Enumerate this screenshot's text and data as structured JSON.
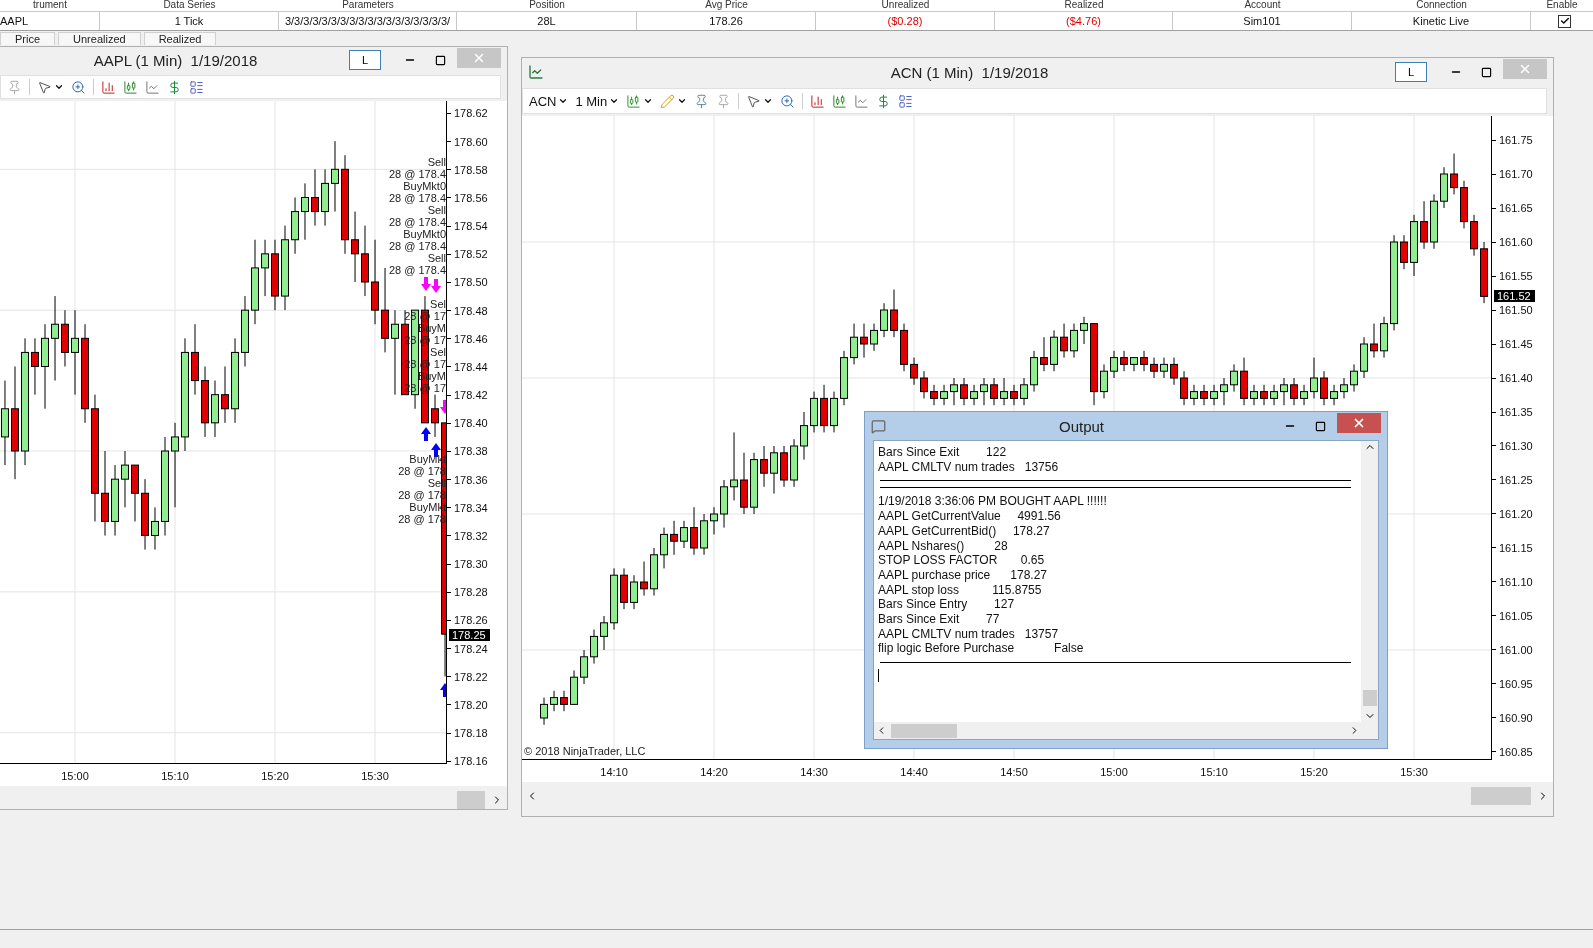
{
  "positions_grid": {
    "columns": [
      "trument",
      "Data Series",
      "Parameters",
      "Position",
      "Avg Price",
      "Unrealized",
      "Realized",
      "Account",
      "Connection",
      "Enable"
    ],
    "row": [
      {
        "kind": "text",
        "text": "AAPL",
        "negative": false
      },
      {
        "kind": "text",
        "text": "1 Tick",
        "negative": false
      },
      {
        "kind": "text",
        "text": "3/3/3/3/3/3/3/3/3/3/3/3/3/3/3/3/3/3/",
        "negative": false
      },
      {
        "kind": "text",
        "text": "28L",
        "negative": false
      },
      {
        "kind": "text",
        "text": "178.26",
        "negative": false
      },
      {
        "kind": "text",
        "text": "($0.28)",
        "negative": true
      },
      {
        "kind": "text",
        "text": "($4.76)",
        "negative": true
      },
      {
        "kind": "text",
        "text": "Sim101",
        "negative": false
      },
      {
        "kind": "text",
        "text": "Kinetic Live",
        "negative": false
      },
      {
        "kind": "checkbox",
        "checked": true
      }
    ]
  },
  "tabs": [
    "Price",
    "Unrealized",
    "Realized"
  ],
  "charts": [
    {
      "title": "AAPL (1 Min)  1/19/2018",
      "lock_label": "L",
      "last_price": "178.25",
      "trade_labels": [
        [
          "Sell",
          "28 @ 178.4",
          "BuyMkt0",
          "28 @ 178.4",
          "Sell",
          "28 @ 178.4",
          "BuyMkt0",
          "28 @ 178.4",
          "Sell",
          "28 @ 178.4"
        ],
        [
          "Sel",
          "28 @ 17",
          "BuyM",
          "28 @ 17",
          "Sel",
          "28 @ 17",
          "BuyM",
          "28 @ 17"
        ],
        [
          "BuyMkt",
          "28 @ 178",
          "Sell",
          "28 @ 178",
          "BuyMkt",
          "28 @ 178"
        ]
      ],
      "chart_data": {
        "type": "candlestick",
        "grid": true,
        "x": [
          14.8833,
          14.9,
          14.9167,
          14.9333,
          14.95,
          14.9667,
          14.9833,
          15,
          15.0167,
          15.0333,
          15.05,
          15.0667,
          15.0833,
          15.1,
          15.1167,
          15.1333,
          15.15,
          15.1667,
          15.1833,
          15.2,
          15.2167,
          15.2333,
          15.25,
          15.2667,
          15.2833,
          15.3,
          15.3167,
          15.3333,
          15.35,
          15.3667,
          15.3833,
          15.4,
          15.4167,
          15.4333,
          15.45,
          15.4667,
          15.4833,
          15.5,
          15.5167,
          15.5333,
          15.55,
          15.5667,
          15.5833,
          15.6,
          15.6167
        ],
        "ohlc": [
          [
            178.39,
            178.43,
            178.37,
            178.41
          ],
          [
            178.41,
            178.44,
            178.36,
            178.38
          ],
          [
            178.38,
            178.46,
            178.37,
            178.45
          ],
          [
            178.45,
            178.46,
            178.42,
            178.44
          ],
          [
            178.44,
            178.47,
            178.41,
            178.46
          ],
          [
            178.46,
            178.49,
            178.43,
            178.47
          ],
          [
            178.47,
            178.48,
            178.44,
            178.45
          ],
          [
            178.45,
            178.48,
            178.42,
            178.46
          ],
          [
            178.46,
            178.47,
            178.4,
            178.41
          ],
          [
            178.41,
            178.42,
            178.33,
            178.35
          ],
          [
            178.35,
            178.38,
            178.32,
            178.33
          ],
          [
            178.33,
            178.37,
            178.32,
            178.36
          ],
          [
            178.36,
            178.38,
            178.34,
            178.37
          ],
          [
            178.37,
            178.37,
            178.33,
            178.35
          ],
          [
            178.35,
            178.36,
            178.31,
            178.32
          ],
          [
            178.32,
            178.34,
            178.31,
            178.33
          ],
          [
            178.33,
            178.39,
            178.32,
            178.38
          ],
          [
            178.38,
            178.4,
            178.34,
            178.39
          ],
          [
            178.39,
            178.46,
            178.38,
            178.45
          ],
          [
            178.45,
            178.47,
            178.42,
            178.43
          ],
          [
            178.43,
            178.44,
            178.39,
            178.4
          ],
          [
            178.4,
            178.43,
            178.39,
            178.42
          ],
          [
            178.42,
            178.44,
            178.4,
            178.41
          ],
          [
            178.41,
            178.46,
            178.4,
            178.45
          ],
          [
            178.45,
            178.49,
            178.44,
            178.48
          ],
          [
            178.48,
            178.53,
            178.47,
            178.51
          ],
          [
            178.51,
            178.53,
            178.49,
            178.52
          ],
          [
            178.52,
            178.53,
            178.48,
            178.49
          ],
          [
            178.49,
            178.54,
            178.48,
            178.53
          ],
          [
            178.53,
            178.56,
            178.52,
            178.55
          ],
          [
            178.55,
            178.57,
            178.53,
            178.56
          ],
          [
            178.56,
            178.58,
            178.54,
            178.55
          ],
          [
            178.55,
            178.58,
            178.54,
            178.57
          ],
          [
            178.57,
            178.6,
            178.55,
            178.58
          ],
          [
            178.58,
            178.59,
            178.52,
            178.53
          ],
          [
            178.53,
            178.55,
            178.5,
            178.52
          ],
          [
            178.52,
            178.54,
            178.49,
            178.5
          ],
          [
            178.5,
            178.53,
            178.47,
            178.48
          ],
          [
            178.48,
            178.51,
            178.45,
            178.46
          ],
          [
            178.46,
            178.48,
            178.42,
            178.47
          ],
          [
            178.47,
            178.48,
            178.42,
            178.42
          ],
          [
            178.42,
            178.48,
            178.41,
            178.48
          ],
          [
            178.48,
            178.49,
            178.4,
            178.4
          ],
          [
            178.41,
            178.42,
            178.39,
            178.4
          ],
          [
            178.4,
            178.4,
            178.22,
            178.25
          ]
        ],
        "xticks": [
          {
            "value": 15,
            "label": "15:00"
          },
          {
            "value": 15.1667,
            "label": "15:10"
          },
          {
            "value": 15.3333,
            "label": "15:20"
          },
          {
            "value": 15.5,
            "label": "15:30"
          }
        ],
        "xlim": [
          14.875,
          15.6183
        ],
        "ylim": [
          178.1585,
          178.6285
        ],
        "yticks": [
          {
            "value": 178.62,
            "label": "178.62"
          },
          {
            "value": 178.6,
            "label": "178.60"
          },
          {
            "value": 178.58,
            "label": "178.58"
          },
          {
            "value": 178.56,
            "label": "178.56"
          },
          {
            "value": 178.54,
            "label": "178.54"
          },
          {
            "value": 178.52,
            "label": "178.52"
          },
          {
            "value": 178.5,
            "label": "178.50"
          },
          {
            "value": 178.48,
            "label": "178.48"
          },
          {
            "value": 178.46,
            "label": "178.46"
          },
          {
            "value": 178.44,
            "label": "178.44"
          },
          {
            "value": 178.42,
            "label": "178.42"
          },
          {
            "value": 178.4,
            "label": "178.40"
          },
          {
            "value": 178.38,
            "label": "178.38"
          },
          {
            "value": 178.36,
            "label": "178.36"
          },
          {
            "value": 178.34,
            "label": "178.34"
          },
          {
            "value": 178.32,
            "label": "178.32"
          },
          {
            "value": 178.3,
            "label": "178.30"
          },
          {
            "value": 178.28,
            "label": "178.28"
          },
          {
            "value": 178.26,
            "label": "178.26"
          },
          {
            "value": 178.24,
            "label": "178.24"
          },
          {
            "value": 178.22,
            "label": "178.22"
          },
          {
            "value": 178.2,
            "label": "178.20"
          },
          {
            "value": 178.18,
            "label": "178.18"
          },
          {
            "value": 178.16,
            "label": "178.16"
          }
        ]
      }
    },
    {
      "title": "ACN (1 Min)  1/19/2018",
      "lock_label": "L",
      "instrument": "ACN",
      "interval": "1 Min",
      "last_price": "161.52",
      "copyright": "© 2018 NinjaTrader, LLC",
      "chart_data": {
        "type": "candlestick",
        "grid": true,
        "x": [
          14.05,
          14.0667,
          14.0833,
          14.1,
          14.1167,
          14.1333,
          14.15,
          14.1667,
          14.1833,
          14.2,
          14.2167,
          14.2333,
          14.25,
          14.2667,
          14.2833,
          14.3,
          14.3167,
          14.3333,
          14.35,
          14.3667,
          14.3833,
          14.4,
          14.4167,
          14.4333,
          14.45,
          14.4667,
          14.4833,
          14.5,
          14.5167,
          14.5333,
          14.55,
          14.5667,
          14.5833,
          14.6,
          14.6167,
          14.6333,
          14.65,
          14.6667,
          14.6833,
          14.7,
          14.7167,
          14.7333,
          14.75,
          14.7667,
          14.7833,
          14.8,
          14.8167,
          14.8333,
          14.85,
          14.8667,
          14.8833,
          14.9,
          14.9167,
          14.9333,
          14.95,
          14.9667,
          14.9833,
          15,
          15.0167,
          15.0333,
          15.05,
          15.0667,
          15.0833,
          15.1,
          15.1167,
          15.1333,
          15.15,
          15.1667,
          15.1833,
          15.2,
          15.2167,
          15.2333,
          15.25,
          15.2667,
          15.2833,
          15.3,
          15.3167,
          15.3333,
          15.35,
          15.3667,
          15.3833,
          15.4,
          15.4167,
          15.4333,
          15.45,
          15.4667,
          15.4833,
          15.5,
          15.5167,
          15.5333,
          15.55,
          15.5667,
          15.5833,
          15.6,
          15.6167
        ],
        "ohlc": [
          [
            160.9,
            160.93,
            160.89,
            160.92
          ],
          [
            160.92,
            160.94,
            160.91,
            160.93
          ],
          [
            160.93,
            160.94,
            160.91,
            160.92
          ],
          [
            160.92,
            160.97,
            160.92,
            160.96
          ],
          [
            160.96,
            161.0,
            160.95,
            160.99
          ],
          [
            160.99,
            161.03,
            160.98,
            161.02
          ],
          [
            161.02,
            161.05,
            161.0,
            161.04
          ],
          [
            161.04,
            161.12,
            161.03,
            161.11
          ],
          [
            161.11,
            161.12,
            161.06,
            161.07
          ],
          [
            161.07,
            161.11,
            161.06,
            161.1
          ],
          [
            161.1,
            161.13,
            161.08,
            161.09
          ],
          [
            161.09,
            161.15,
            161.08,
            161.14
          ],
          [
            161.14,
            161.18,
            161.12,
            161.17
          ],
          [
            161.17,
            161.19,
            161.14,
            161.16
          ],
          [
            161.16,
            161.19,
            161.15,
            161.18
          ],
          [
            161.18,
            161.21,
            161.14,
            161.15
          ],
          [
            161.15,
            161.2,
            161.14,
            161.19
          ],
          [
            161.19,
            161.21,
            161.17,
            161.2
          ],
          [
            161.2,
            161.25,
            161.18,
            161.24
          ],
          [
            161.24,
            161.32,
            161.22,
            161.25
          ],
          [
            161.25,
            161.29,
            161.2,
            161.21
          ],
          [
            161.21,
            161.29,
            161.2,
            161.28
          ],
          [
            161.28,
            161.3,
            161.24,
            161.26
          ],
          [
            161.26,
            161.3,
            161.23,
            161.29
          ],
          [
            161.29,
            161.3,
            161.24,
            161.25
          ],
          [
            161.25,
            161.31,
            161.24,
            161.3
          ],
          [
            161.3,
            161.35,
            161.28,
            161.33
          ],
          [
            161.33,
            161.38,
            161.32,
            161.37
          ],
          [
            161.37,
            161.39,
            161.32,
            161.33
          ],
          [
            161.33,
            161.38,
            161.32,
            161.37
          ],
          [
            161.37,
            161.44,
            161.36,
            161.43
          ],
          [
            161.43,
            161.48,
            161.42,
            161.46
          ],
          [
            161.46,
            161.48,
            161.43,
            161.45
          ],
          [
            161.45,
            161.48,
            161.44,
            161.47
          ],
          [
            161.47,
            161.51,
            161.46,
            161.5
          ],
          [
            161.5,
            161.53,
            161.46,
            161.47
          ],
          [
            161.47,
            161.48,
            161.41,
            161.42
          ],
          [
            161.42,
            161.43,
            161.39,
            161.4
          ],
          [
            161.4,
            161.41,
            161.37,
            161.38
          ],
          [
            161.38,
            161.39,
            161.36,
            161.37
          ],
          [
            161.37,
            161.39,
            161.36,
            161.38
          ],
          [
            161.38,
            161.4,
            161.36,
            161.39
          ],
          [
            161.39,
            161.4,
            161.36,
            161.37
          ],
          [
            161.37,
            161.39,
            161.36,
            161.38
          ],
          [
            161.38,
            161.4,
            161.36,
            161.39
          ],
          [
            161.39,
            161.4,
            161.36,
            161.37
          ],
          [
            161.37,
            161.4,
            161.36,
            161.38
          ],
          [
            161.38,
            161.39,
            161.36,
            161.37
          ],
          [
            161.37,
            161.4,
            161.36,
            161.39
          ],
          [
            161.39,
            161.44,
            161.38,
            161.43
          ],
          [
            161.43,
            161.46,
            161.41,
            161.42
          ],
          [
            161.42,
            161.47,
            161.41,
            161.46
          ],
          [
            161.46,
            161.48,
            161.43,
            161.44
          ],
          [
            161.44,
            161.48,
            161.43,
            161.47
          ],
          [
            161.47,
            161.49,
            161.45,
            161.48
          ],
          [
            161.48,
            161.48,
            161.36,
            161.38
          ],
          [
            161.38,
            161.42,
            161.37,
            161.41
          ],
          [
            161.41,
            161.44,
            161.4,
            161.43
          ],
          [
            161.43,
            161.44,
            161.41,
            161.42
          ],
          [
            161.42,
            161.43,
            161.41,
            161.43
          ],
          [
            161.43,
            161.44,
            161.41,
            161.42
          ],
          [
            161.42,
            161.43,
            161.4,
            161.41
          ],
          [
            161.41,
            161.43,
            161.4,
            161.42
          ],
          [
            161.42,
            161.43,
            161.39,
            161.4
          ],
          [
            161.4,
            161.41,
            161.36,
            161.37
          ],
          [
            161.37,
            161.39,
            161.36,
            161.38
          ],
          [
            161.38,
            161.39,
            161.36,
            161.37
          ],
          [
            161.37,
            161.39,
            161.36,
            161.38
          ],
          [
            161.38,
            161.4,
            161.36,
            161.39
          ],
          [
            161.39,
            161.42,
            161.38,
            161.41
          ],
          [
            161.41,
            161.43,
            161.36,
            161.37
          ],
          [
            161.37,
            161.39,
            161.36,
            161.38
          ],
          [
            161.38,
            161.39,
            161.36,
            161.37
          ],
          [
            161.37,
            161.39,
            161.36,
            161.38
          ],
          [
            161.38,
            161.4,
            161.36,
            161.39
          ],
          [
            161.39,
            161.4,
            161.36,
            161.37
          ],
          [
            161.37,
            161.39,
            161.36,
            161.38
          ],
          [
            161.38,
            161.43,
            161.37,
            161.4
          ],
          [
            161.4,
            161.41,
            161.36,
            161.37
          ],
          [
            161.37,
            161.39,
            161.36,
            161.38
          ],
          [
            161.38,
            161.4,
            161.37,
            161.39
          ],
          [
            161.39,
            161.42,
            161.38,
            161.41
          ],
          [
            161.41,
            161.46,
            161.4,
            161.45
          ],
          [
            161.45,
            161.48,
            161.43,
            161.44
          ],
          [
            161.44,
            161.49,
            161.43,
            161.48
          ],
          [
            161.48,
            161.61,
            161.47,
            161.6
          ],
          [
            161.6,
            161.61,
            161.56,
            161.57
          ],
          [
            161.57,
            161.64,
            161.55,
            161.63
          ],
          [
            161.63,
            161.66,
            161.59,
            161.6
          ],
          [
            161.6,
            161.67,
            161.59,
            161.66
          ],
          [
            161.66,
            161.71,
            161.65,
            161.7
          ],
          [
            161.7,
            161.73,
            161.67,
            161.68
          ],
          [
            161.68,
            161.69,
            161.62,
            161.63
          ],
          [
            161.63,
            161.64,
            161.58,
            161.59
          ],
          [
            161.59,
            161.6,
            161.51,
            161.52
          ]
        ],
        "xticks": [
          {
            "value": 14.1667,
            "label": "14:10"
          },
          {
            "value": 14.3333,
            "label": "14:20"
          },
          {
            "value": 14.5,
            "label": "14:30"
          },
          {
            "value": 14.6667,
            "label": "14:40"
          },
          {
            "value": 14.8333,
            "label": "14:50"
          },
          {
            "value": 15,
            "label": "15:00"
          },
          {
            "value": 15.1667,
            "label": "15:10"
          },
          {
            "value": 15.3333,
            "label": "15:20"
          },
          {
            "value": 15.5,
            "label": "15:30"
          }
        ],
        "xlim": [
          14.0133,
          15.6283
        ],
        "ylim": [
          160.8397,
          161.7853
        ],
        "yticks": [
          {
            "value": 161.75,
            "label": "161.75"
          },
          {
            "value": 161.7,
            "label": "161.70"
          },
          {
            "value": 161.65,
            "label": "161.65"
          },
          {
            "value": 161.6,
            "label": "161.60"
          },
          {
            "value": 161.55,
            "label": "161.55"
          },
          {
            "value": 161.5,
            "label": "161.50"
          },
          {
            "value": 161.45,
            "label": "161.45"
          },
          {
            "value": 161.4,
            "label": "161.40"
          },
          {
            "value": 161.35,
            "label": "161.35"
          },
          {
            "value": 161.3,
            "label": "161.30"
          },
          {
            "value": 161.25,
            "label": "161.25"
          },
          {
            "value": 161.2,
            "label": "161.20"
          },
          {
            "value": 161.15,
            "label": "161.15"
          },
          {
            "value": 161.1,
            "label": "161.10"
          },
          {
            "value": 161.05,
            "label": "161.05"
          },
          {
            "value": 161.0,
            "label": "161.00"
          },
          {
            "value": 160.95,
            "label": "160.95"
          },
          {
            "value": 160.9,
            "label": "160.90"
          },
          {
            "value": 160.85,
            "label": "160.85"
          }
        ]
      }
    }
  ],
  "output": {
    "title": "Output",
    "lines": [
      {
        "kind": "text",
        "text": "Bars Since Exit        122"
      },
      {
        "kind": "text",
        "text": "AAPL CMLTV num trades   13756"
      },
      {
        "kind": "rule"
      },
      {
        "kind": "rule"
      },
      {
        "kind": "text",
        "text": "1/19/2018 3:36:06 PM BOUGHT AAPL !!!!!!"
      },
      {
        "kind": "text",
        "text": "AAPL GetCurrentValue     4991.56"
      },
      {
        "kind": "text",
        "text": "AAPL GetCurrentBid()     178.27"
      },
      {
        "kind": "text",
        "text": "AAPL Nshares()         28"
      },
      {
        "kind": "text",
        "text": "STOP LOSS FACTOR       0.65"
      },
      {
        "kind": "text",
        "text": "AAPL purchase price      178.27"
      },
      {
        "kind": "text",
        "text": "AAPL stop loss          115.8755"
      },
      {
        "kind": "text",
        "text": "Bars Since Entry        127"
      },
      {
        "kind": "text",
        "text": "Bars Since Exit        77"
      },
      {
        "kind": "text",
        "text": "AAPL CMLTV num trades   13757"
      },
      {
        "kind": "text",
        "text": "flip logic Before Purchase            False"
      },
      {
        "kind": "rule"
      },
      {
        "kind": "cursor"
      }
    ]
  }
}
